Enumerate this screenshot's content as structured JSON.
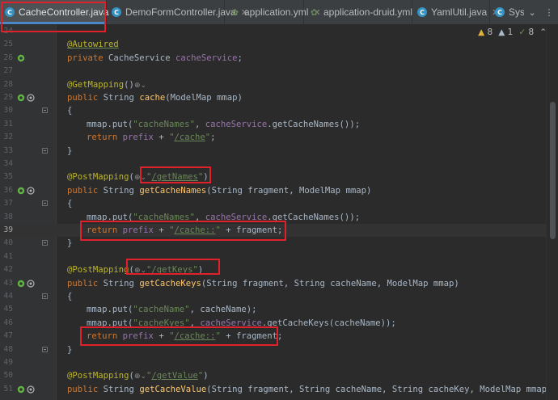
{
  "tabs": [
    {
      "label": "CacheController.java",
      "icon": "java-class-icon",
      "active": true
    },
    {
      "label": "DemoFormController.java",
      "icon": "java-class-icon",
      "active": false
    },
    {
      "label": "application.yml",
      "icon": "yaml-icon",
      "active": false
    },
    {
      "label": "application-druid.yml",
      "icon": "yaml-icon",
      "active": false
    },
    {
      "label": "YamlUtil.java",
      "icon": "java-class-icon",
      "active": false
    },
    {
      "label": "SysJ",
      "icon": "java-class-icon",
      "active": false
    }
  ],
  "inspections": {
    "warnings": "8",
    "weak_warnings": "1",
    "checks": "8"
  },
  "lines": [
    {
      "num": "24"
    },
    {
      "num": "25",
      "text": "@Autowired"
    },
    {
      "num": "26",
      "text": "private CacheService cacheService;"
    },
    {
      "num": "27"
    },
    {
      "num": "28",
      "text": "@GetMapping()"
    },
    {
      "num": "29",
      "text": "public String cache(ModelMap mmap)"
    },
    {
      "num": "30",
      "text": "{"
    },
    {
      "num": "31",
      "text": "mmap.put(\"cacheNames\", cacheService.getCacheNames());"
    },
    {
      "num": "32",
      "text": "return prefix + \"/cache\";"
    },
    {
      "num": "33",
      "text": "}"
    },
    {
      "num": "34"
    },
    {
      "num": "35",
      "text": "@PostMapping(\"/getNames\")"
    },
    {
      "num": "36",
      "text": "public String getCacheNames(String fragment, ModelMap mmap)"
    },
    {
      "num": "37",
      "text": "{"
    },
    {
      "num": "38",
      "text": "mmap.put(\"cacheNames\", cacheService.getCacheNames());"
    },
    {
      "num": "39",
      "text": "return prefix + \"/cache::\" + fragment;"
    },
    {
      "num": "40",
      "text": "}"
    },
    {
      "num": "41"
    },
    {
      "num": "42",
      "text": "@PostMapping(\"/getKeys\")"
    },
    {
      "num": "43",
      "text": "public String getCacheKeys(String fragment, String cacheName, ModelMap mmap)"
    },
    {
      "num": "44",
      "text": "{"
    },
    {
      "num": "45",
      "text": "mmap.put(\"cacheName\", cacheName);"
    },
    {
      "num": "46",
      "text": "mmap.put(\"cacheKyes\", cacheService.getCacheKeys(cacheName));"
    },
    {
      "num": "47",
      "text": "return prefix + \"/cache::\" + fragment;"
    },
    {
      "num": "48",
      "text": "}"
    },
    {
      "num": "49"
    },
    {
      "num": "50",
      "text": "@PostMapping(\"/getValue\")"
    },
    {
      "num": "51",
      "text": "public String getCacheValue(String fragment, String cacheName, String cacheKey, ModelMap mmap)"
    }
  ],
  "colors": {
    "highlight": "#e0212b",
    "background": "#2b2b2b",
    "keyword": "#cc7832",
    "string": "#6a8759",
    "annotation": "#bbb529",
    "field": "#9876aa",
    "method": "#ffc66d"
  }
}
